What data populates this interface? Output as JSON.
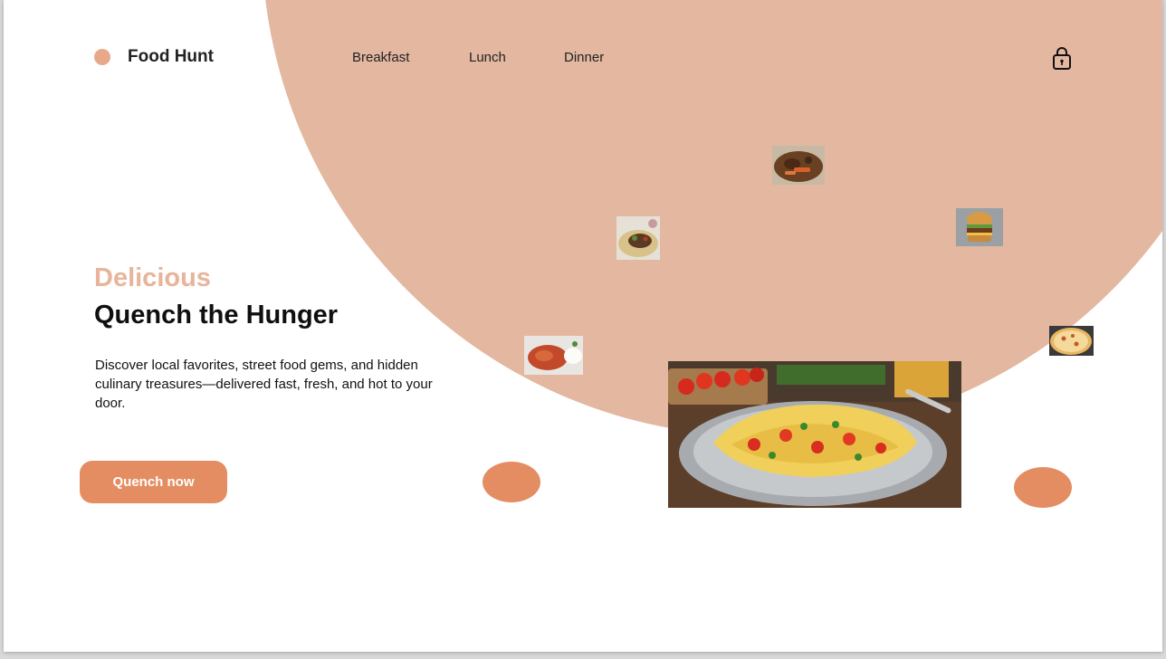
{
  "brand": {
    "name": "Food Hunt"
  },
  "nav": {
    "items": [
      "Breakfast",
      "Lunch",
      "Dinner"
    ]
  },
  "hero": {
    "eyebrow": "Delicious",
    "headline": "Quench the Hunger",
    "description": "Discover local favorites, street food gems, and hidden culinary treasures—delivered fast, fresh, and hot to your door.",
    "cta_label": "Quench now"
  },
  "icons": {
    "cart": "lock-bag-icon"
  },
  "colors": {
    "accent": "#e48d63",
    "circle": "#e3b7a0",
    "eyebrow": "#e8b49b"
  }
}
